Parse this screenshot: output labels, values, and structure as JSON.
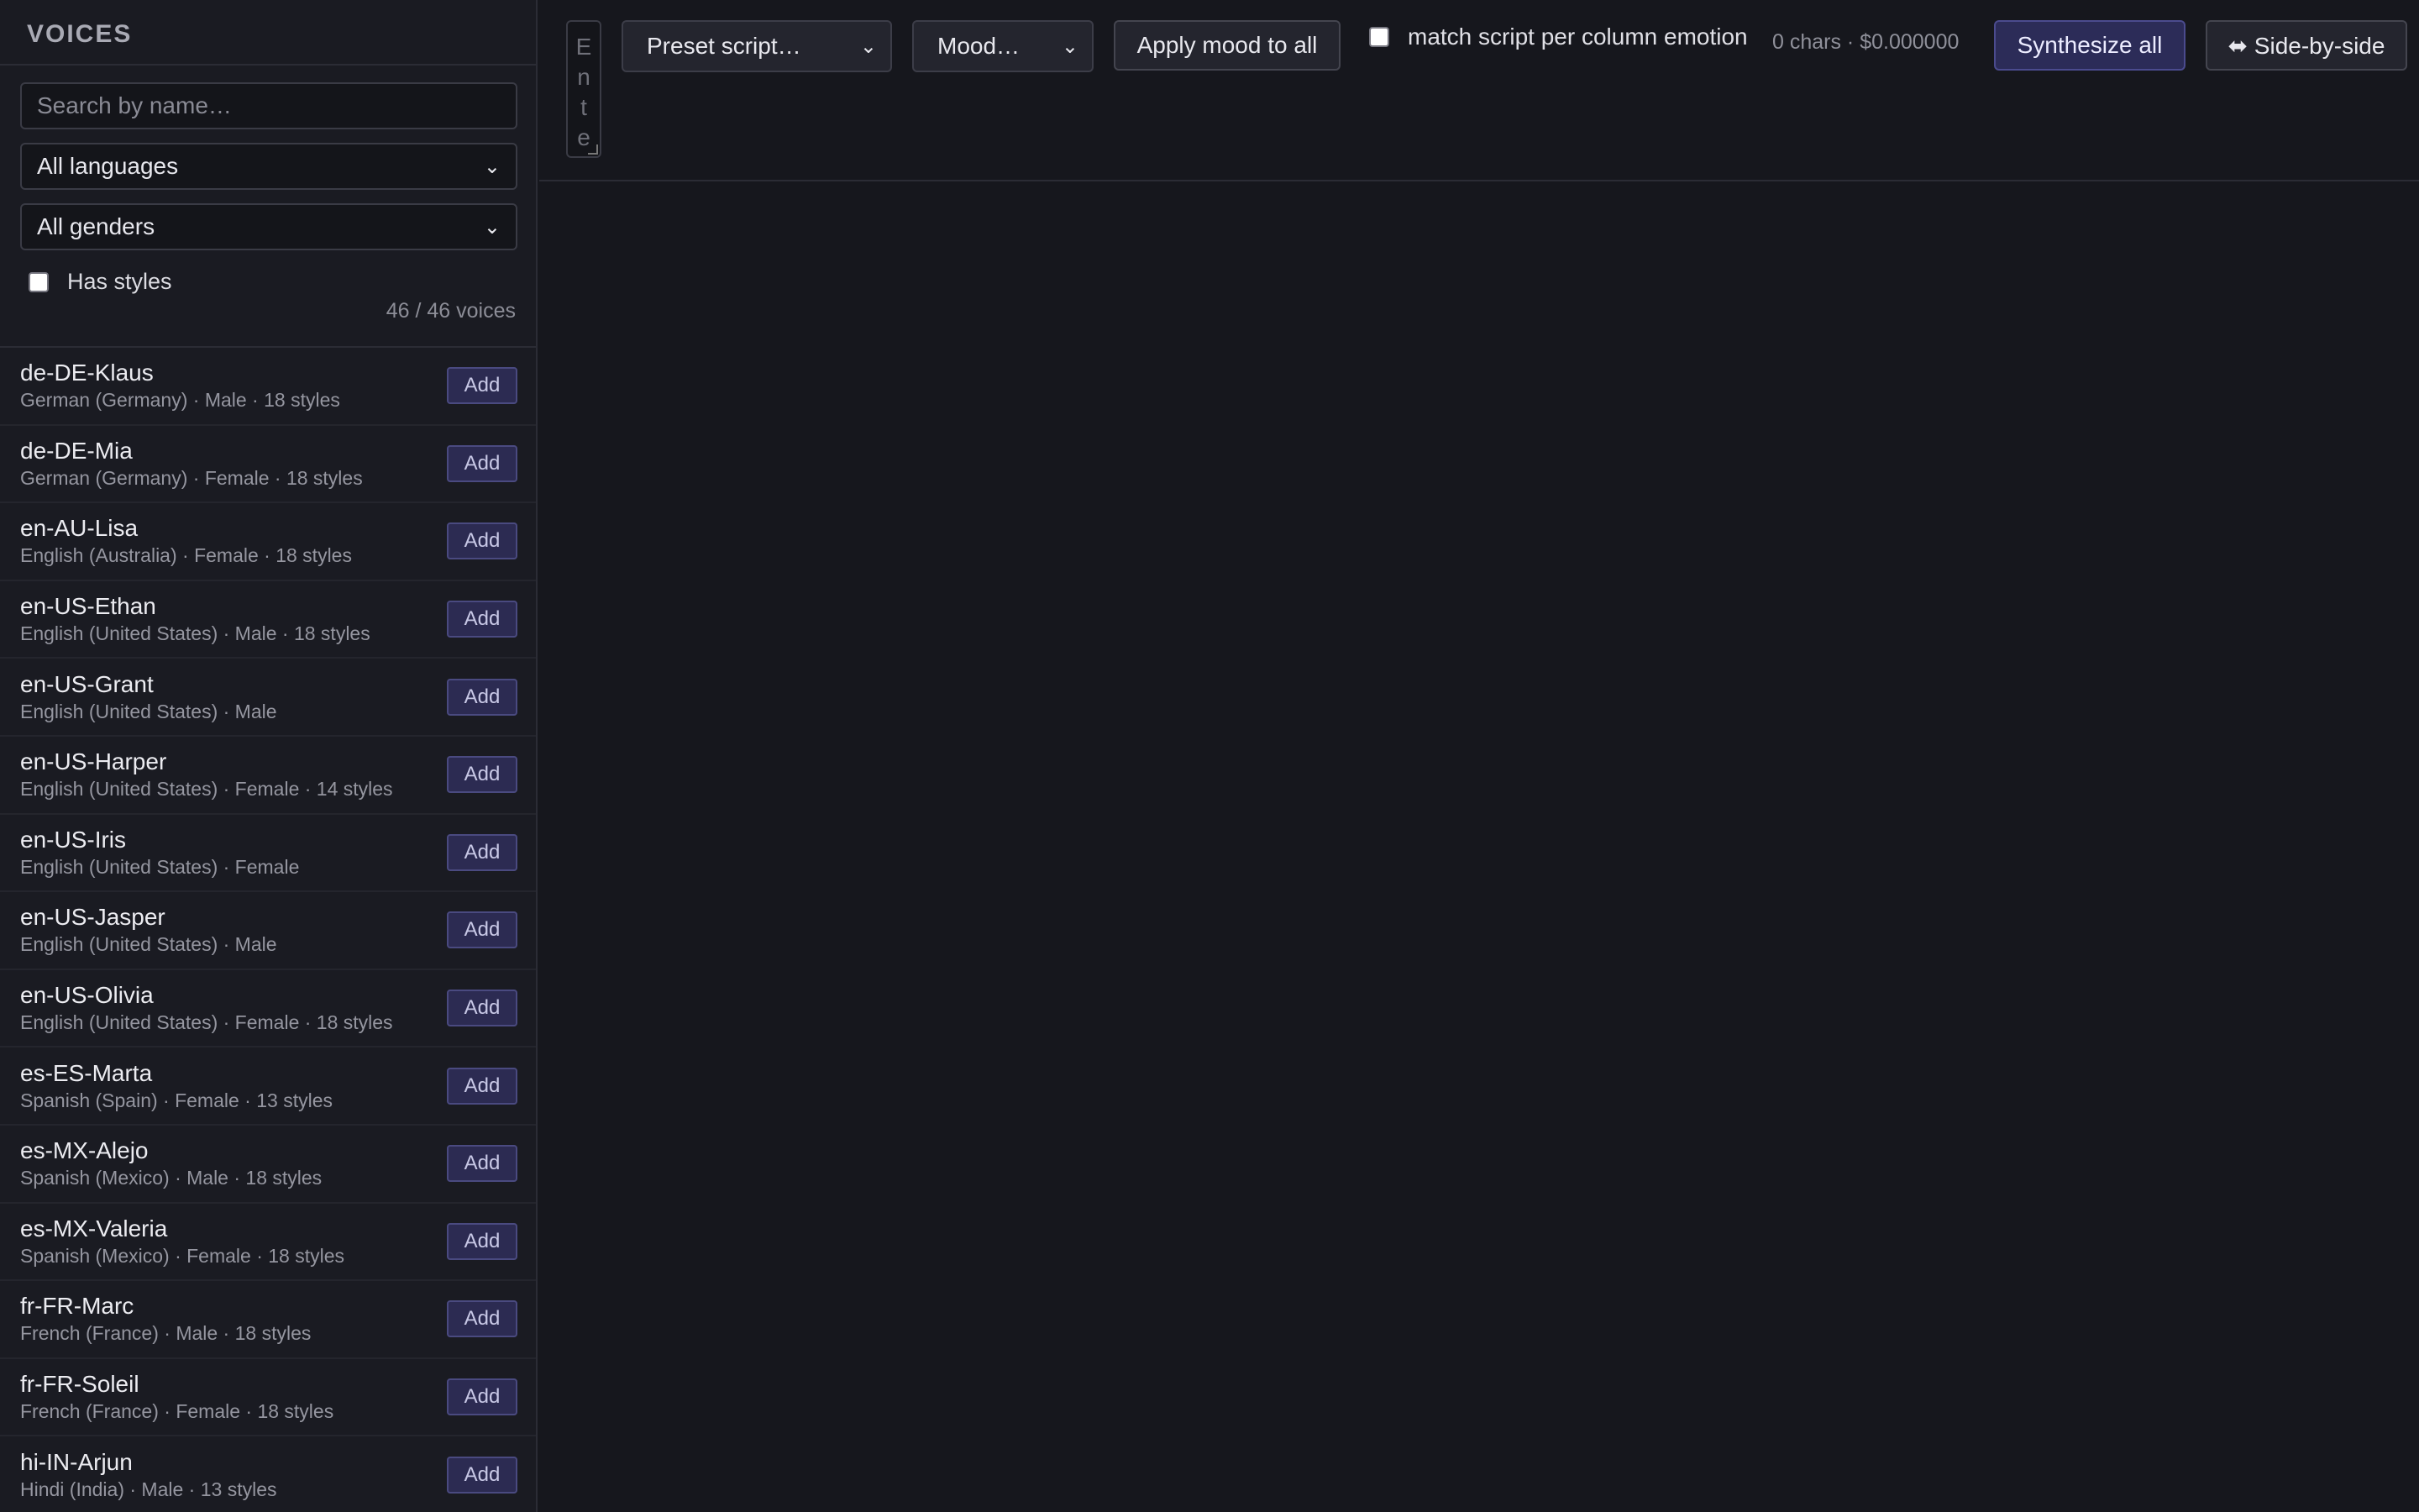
{
  "sidebar": {
    "title": "VOICES",
    "search_placeholder": "Search by name…",
    "language_filter": "All languages",
    "gender_filter": "All genders",
    "has_styles_label": "Has styles",
    "count_text": "46 / 46 voices",
    "add_label": "Add",
    "voices": [
      {
        "name": "de-DE-Klaus",
        "meta": "German (Germany) · Male · 18 styles"
      },
      {
        "name": "de-DE-Mia",
        "meta": "German (Germany) · Female · 18 styles"
      },
      {
        "name": "en-AU-Lisa",
        "meta": "English (Australia) · Female · 18 styles"
      },
      {
        "name": "en-US-Ethan",
        "meta": "English (United States) · Male · 18 styles"
      },
      {
        "name": "en-US-Grant",
        "meta": "English (United States) · Male"
      },
      {
        "name": "en-US-Harper",
        "meta": "English (United States) · Female · 14 styles"
      },
      {
        "name": "en-US-Iris",
        "meta": "English (United States) · Female"
      },
      {
        "name": "en-US-Jasper",
        "meta": "English (United States) · Male"
      },
      {
        "name": "en-US-Olivia",
        "meta": "English (United States) · Female · 18 styles"
      },
      {
        "name": "es-ES-Marta",
        "meta": "Spanish (Spain) · Female · 13 styles"
      },
      {
        "name": "es-MX-Alejo",
        "meta": "Spanish (Mexico) · Male · 18 styles"
      },
      {
        "name": "es-MX-Valeria",
        "meta": "Spanish (Mexico) · Female · 18 styles"
      },
      {
        "name": "fr-FR-Marc",
        "meta": "French (France) · Male · 18 styles"
      },
      {
        "name": "fr-FR-Soleil",
        "meta": "French (France) · Female · 18 styles"
      },
      {
        "name": "hi-IN-Arjun",
        "meta": "Hindi (India) · Male · 13 styles"
      }
    ]
  },
  "toolbar": {
    "script_placeholder": "Ente",
    "preset_script": "Preset script…",
    "mood": "Mood…",
    "apply_mood_label": "Apply mood to all",
    "match_label": "match script per column emotion",
    "stats_text": "0 chars · $0.000000",
    "synthesize_label": "Synthesize all",
    "side_by_side_label": "⬌ Side-by-side"
  },
  "colors": {
    "background": "#16171d",
    "sidebar": "#1a1b22",
    "accent": "#2c2c58"
  },
  "icons": {
    "select_arrow": "chevron-down-icon",
    "side_by_side": "double-arrow-icon"
  }
}
